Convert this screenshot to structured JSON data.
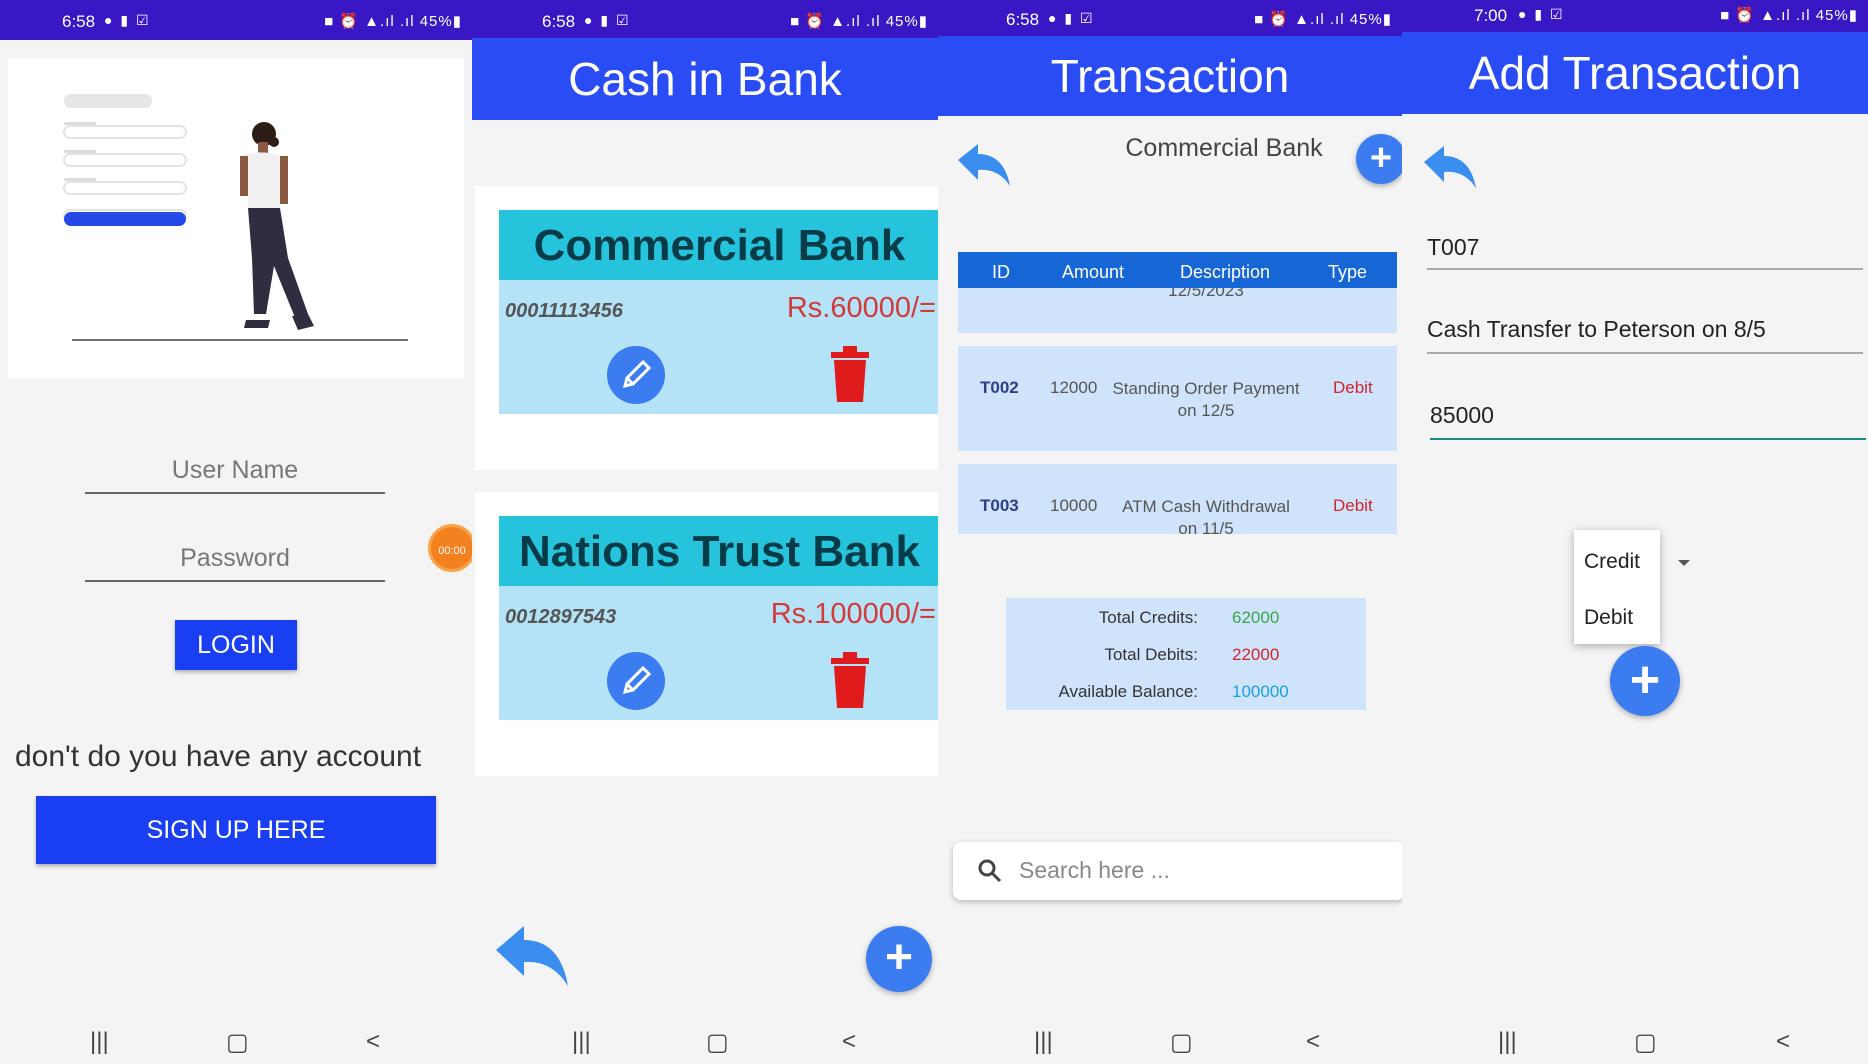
{
  "status": {
    "s1_time": "6:58",
    "s2_time": "6:58",
    "s3_time": "6:58",
    "s4_time": "7:00",
    "battery": "45%"
  },
  "login": {
    "username_placeholder": "User Name",
    "password_placeholder": "Password",
    "login_label": "LOGIN",
    "hint": "don't do you have any account",
    "signup_label": "SIGN UP HERE",
    "timer": "00:00"
  },
  "bank_list": {
    "title": "Cash in Bank",
    "banks": [
      {
        "name": "Commercial Bank",
        "account": "00011113456",
        "amount": "Rs.60000/="
      },
      {
        "name": "Nations Trust Bank",
        "account": "0012897543",
        "amount": "Rs.100000/="
      }
    ]
  },
  "transactions": {
    "title": "Transaction",
    "bank_name": "Commercial Bank",
    "headers": {
      "id": "ID",
      "amount": "Amount",
      "description": "Description",
      "type": "Type"
    },
    "partial_row": "12/5/2023",
    "rows": [
      {
        "id": "T002",
        "amount": "12000",
        "desc_line1": "Standing Order Payment",
        "desc_line2": "on 12/5",
        "type": "Debit"
      },
      {
        "id": "T003",
        "amount": "10000",
        "desc_line1": "ATM Cash Withdrawal",
        "desc_line2": "on 11/5",
        "type": "Debit"
      }
    ],
    "totals": {
      "credits_label": "Total Credits:",
      "credits_value": "62000",
      "debits_label": "Total Debits:",
      "debits_value": "22000",
      "balance_label": "Available Balance:",
      "balance_value": "100000"
    },
    "search_placeholder": "Search here ..."
  },
  "add_transaction": {
    "title": "Add Transaction",
    "id_value": "T007",
    "description_value": "Cash Transfer to Peterson on 8/5",
    "amount_value": "85000",
    "type_options": [
      "Credit",
      "Debit"
    ]
  },
  "colors": {
    "status_bar": "#3a17c4",
    "app_bar": "#2a4cf5",
    "fab": "#3b7cf0",
    "debit": "#d0252f",
    "credit": "#3aa54a",
    "balance": "#1aa0e0"
  }
}
